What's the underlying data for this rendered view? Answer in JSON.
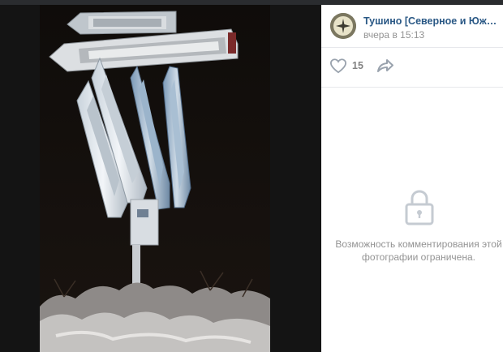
{
  "post": {
    "group_name": "Тушино [Северное и Южное], наде...",
    "time": "вчера в 15:13",
    "likes": "15"
  },
  "comments": {
    "restricted_text": "Возможность комментирования этой фотографии ограничена."
  },
  "icons": {
    "like": "heart-icon",
    "share": "share-arrow-icon",
    "lock": "lock-icon"
  },
  "colors": {
    "link": "#2a5885",
    "muted": "#939393",
    "viewer_bg": "#1f1f1f"
  }
}
